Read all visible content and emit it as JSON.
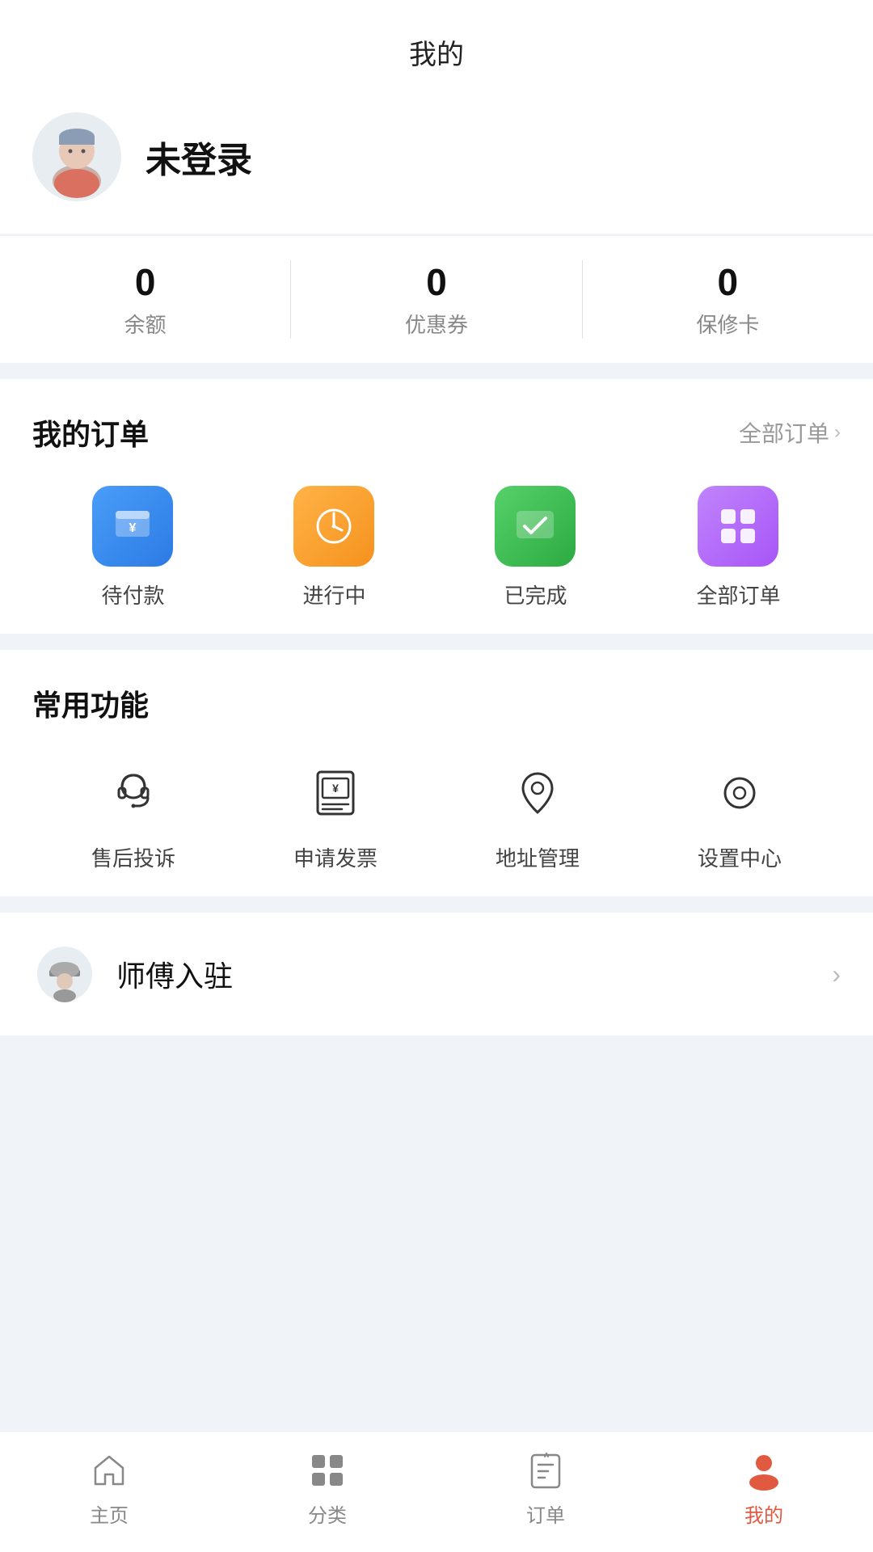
{
  "header": {
    "title": "我的"
  },
  "profile": {
    "username": "未登录"
  },
  "stats": [
    {
      "value": "0",
      "label": "余额"
    },
    {
      "value": "0",
      "label": "优惠券"
    },
    {
      "value": "0",
      "label": "保修卡"
    }
  ],
  "orders": {
    "section_title": "我的订单",
    "all_link": "全部订单",
    "items": [
      {
        "key": "pending-payment",
        "label": "待付款"
      },
      {
        "key": "in-progress",
        "label": "进行中"
      },
      {
        "key": "completed",
        "label": "已完成"
      },
      {
        "key": "all-orders",
        "label": "全部订单"
      }
    ]
  },
  "functions": {
    "section_title": "常用功能",
    "items": [
      {
        "key": "after-sale",
        "label": "售后投诉"
      },
      {
        "key": "invoice",
        "label": "申请发票"
      },
      {
        "key": "address",
        "label": "地址管理"
      },
      {
        "key": "settings",
        "label": "设置中心"
      }
    ]
  },
  "master_entry": {
    "label": "师傅入驻"
  },
  "bottom_nav": [
    {
      "key": "home",
      "label": "主页",
      "active": false
    },
    {
      "key": "category",
      "label": "分类",
      "active": false
    },
    {
      "key": "orders",
      "label": "订单",
      "active": false
    },
    {
      "key": "mine",
      "label": "我的",
      "active": true
    }
  ]
}
